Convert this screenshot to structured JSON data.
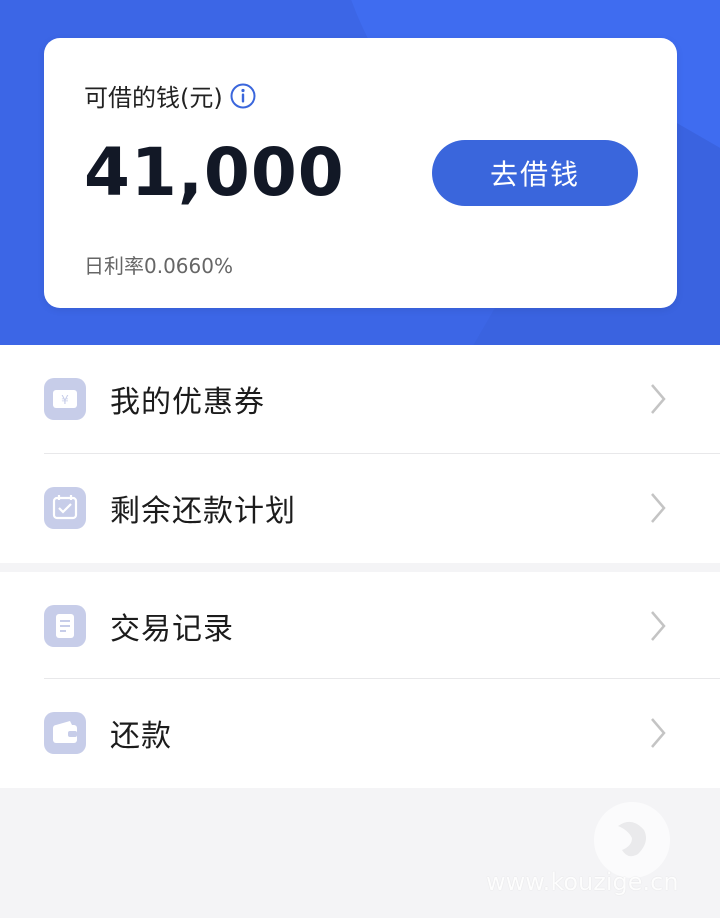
{
  "card": {
    "label": "可借的钱(元)",
    "amount": "41,000",
    "button": "去借钱",
    "rate": "日利率0.0660%"
  },
  "menu": {
    "coupons": "我的优惠券",
    "plan": "剩余还款计划",
    "records": "交易记录",
    "repay": "还款"
  },
  "watermark": "www.kouzige.cn",
  "colors": {
    "brand_blue": "#3c66e6",
    "button_blue": "#3a66dc",
    "icon_bg": "#c7cde9"
  },
  "icons": [
    "info-icon",
    "coupon-icon",
    "calendar-icon",
    "document-icon",
    "wallet-icon",
    "chevron-right-icon"
  ]
}
